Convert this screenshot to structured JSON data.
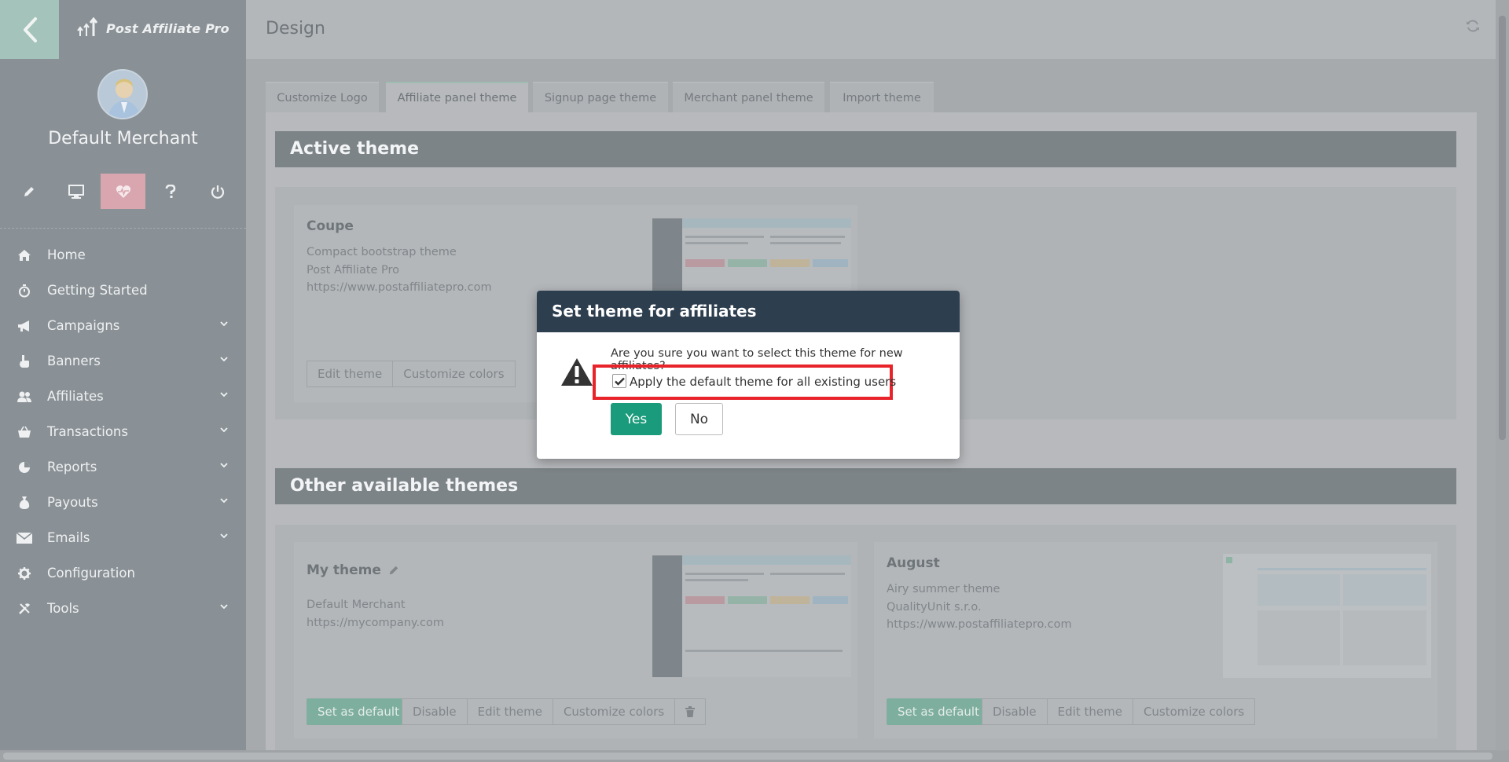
{
  "app": {
    "name": "Post Affiliate Pro",
    "back_icon": "chevron-left-icon",
    "refresh_icon": "refresh-icon"
  },
  "sidebar": {
    "user_name": "Default Merchant",
    "quick_actions": [
      {
        "icon": "pencil-icon"
      },
      {
        "icon": "monitor-icon"
      },
      {
        "icon": "heart-pulse-icon",
        "active": true
      },
      {
        "icon": "question-icon"
      },
      {
        "icon": "power-icon"
      }
    ],
    "menu": [
      {
        "label": "Home",
        "icon": "home-icon",
        "has_submenu": false
      },
      {
        "label": "Getting Started",
        "icon": "stopwatch-icon",
        "has_submenu": false
      },
      {
        "label": "Campaigns",
        "icon": "megaphone-icon",
        "has_submenu": true
      },
      {
        "label": "Banners",
        "icon": "hand-pointer-icon",
        "has_submenu": true
      },
      {
        "label": "Affiliates",
        "icon": "users-icon",
        "has_submenu": true
      },
      {
        "label": "Transactions",
        "icon": "basket-icon",
        "has_submenu": true
      },
      {
        "label": "Reports",
        "icon": "pie-chart-icon",
        "has_submenu": true
      },
      {
        "label": "Payouts",
        "icon": "money-bag-icon",
        "has_submenu": true
      },
      {
        "label": "Emails",
        "icon": "envelope-icon",
        "has_submenu": true
      },
      {
        "label": "Configuration",
        "icon": "gear-icon",
        "has_submenu": false
      },
      {
        "label": "Tools",
        "icon": "tools-icon",
        "has_submenu": true
      }
    ]
  },
  "page": {
    "title": "Design",
    "tabs": [
      {
        "label": "Customize Logo",
        "active": false
      },
      {
        "label": "Affiliate panel theme",
        "active": true
      },
      {
        "label": "Signup page theme",
        "active": false
      },
      {
        "label": "Merchant panel theme",
        "active": false
      },
      {
        "label": "Import theme",
        "active": false
      }
    ]
  },
  "active_theme": {
    "section_title": "Active theme",
    "name": "Coupe",
    "lines": [
      "Compact bootstrap theme",
      "Post Affiliate Pro",
      "https://www.postaffiliatepro.com"
    ],
    "buttons": [
      "Edit theme",
      "Customize colors"
    ]
  },
  "other_themes": {
    "section_title": "Other available themes",
    "themes": [
      {
        "name": "My theme",
        "edit_icon": "pencil-icon",
        "lines": [
          "Default Merchant",
          "https://mycompany.com"
        ],
        "primary_button": "Set as default",
        "buttons": [
          "Disable",
          "Edit theme",
          "Customize colors"
        ],
        "delete_icon": "trash-icon"
      },
      {
        "name": "August",
        "lines": [
          "Airy summer theme",
          "QualityUnit s.r.o.",
          "https://www.postaffiliatepro.com"
        ],
        "primary_button": "Set as default",
        "buttons": [
          "Disable",
          "Edit theme",
          "Customize colors"
        ]
      }
    ]
  },
  "modal": {
    "title": "Set theme for affiliates",
    "warning_icon": "warning-triangle-icon",
    "question": "Are you sure you want to select this theme for new affiliates?",
    "checkbox_label": "Apply the default theme for all existing users",
    "checkbox_checked": true,
    "yes_label": "Yes",
    "no_label": "No"
  },
  "colors": {
    "modal_header": "#2d3e4f",
    "yes_button": "#1a9b7b",
    "highlight": "#e8232a"
  }
}
